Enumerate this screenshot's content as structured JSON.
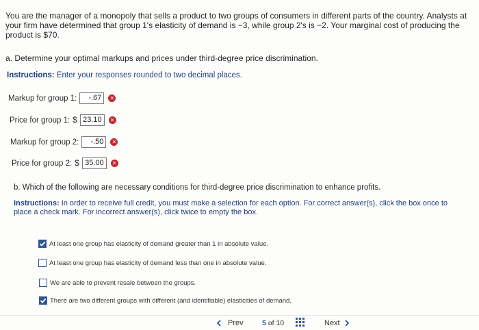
{
  "question": {
    "intro": "You are the manager of a monopoly that sells a product to two groups of consumers in different parts of the country. Analysts at your firm have determined that group 1's elasticity of demand is −3, while group 2's is −2. Your marginal cost of producing the product is $70.",
    "part_a": "a. Determine your optimal markups and prices under third-degree price discrimination.",
    "instructions_a_label": "Instructions:",
    "instructions_a_text": "Enter your responses rounded to two decimal places.",
    "fields": [
      {
        "label": "Markup for group 1:",
        "prefix": "",
        "value": "-.67"
      },
      {
        "label": "Price for group 1:",
        "prefix": "$",
        "value": "23.10"
      },
      {
        "label": "Markup for group 2:",
        "prefix": "",
        "value": "-.50"
      },
      {
        "label": "Price for group 2:",
        "prefix": "$",
        "value": "35.00"
      }
    ],
    "part_b": "b. Which of the following are necessary conditions for third-degree price discrimination to enhance profits.",
    "instructions_b_label": "Instructions:",
    "instructions_b_text": "In order to receive full credit, you must make a selection for each option. For correct answer(s), click the box once to place a check mark. For incorrect answer(s), click twice to empty the box.",
    "options": [
      {
        "text": "At least one group has elasticity of demand greater than 1 in absolute value.",
        "checked": true
      },
      {
        "text": "At least one group has elasticity of demand less than one in absolute value.",
        "checked": false
      },
      {
        "text": "We are able to prevent resale between the groups.",
        "checked": false
      },
      {
        "text": "There are two different groups with different (and identifiable) elasticities of demand.",
        "checked": true
      }
    ]
  },
  "pager": {
    "prev_label": "Prev",
    "page_current": "5",
    "page_of": "of",
    "page_total": "10",
    "next_label": "Next"
  },
  "colors": {
    "instruction_blue": "#1f3f7a",
    "checkbox_blue": "#2d5597",
    "error_red": "#c4262e"
  }
}
